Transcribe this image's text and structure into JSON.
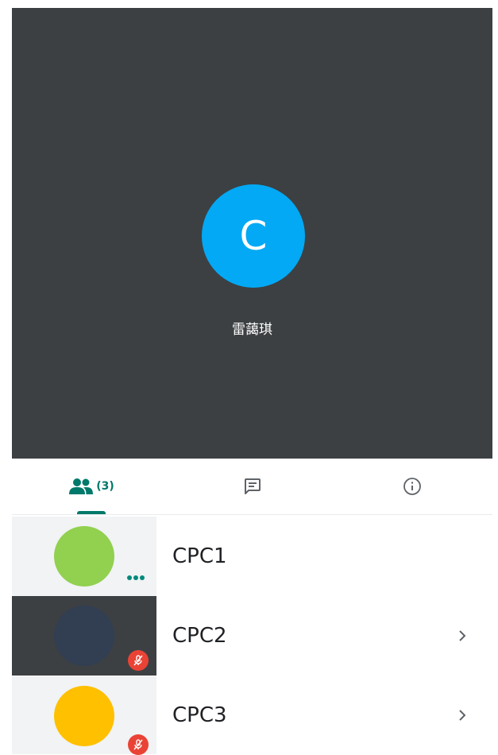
{
  "presenter": {
    "initial": "C",
    "name": "雷藹琪",
    "avatar_color": "#03a9f4"
  },
  "tabs": [
    {
      "id": "people",
      "icon": "people-icon",
      "count": "(3)",
      "active": true
    },
    {
      "id": "chat",
      "icon": "chat-icon",
      "active": false
    },
    {
      "id": "info",
      "icon": "info-icon",
      "active": false
    }
  ],
  "participants": [
    {
      "name": "CPC1",
      "avatar_color": "#92d050",
      "status": "more-options",
      "has_chevron": false
    },
    {
      "name": "CPC2",
      "avatar_color": "#323e52",
      "status": "muted",
      "has_chevron": true
    },
    {
      "name": "CPC3",
      "avatar_color": "#ffc000",
      "status": "muted",
      "has_chevron": true
    }
  ],
  "colors": {
    "accent": "#00796b",
    "stage_bg": "#3c4043",
    "muted_badge": "#ea4335"
  }
}
